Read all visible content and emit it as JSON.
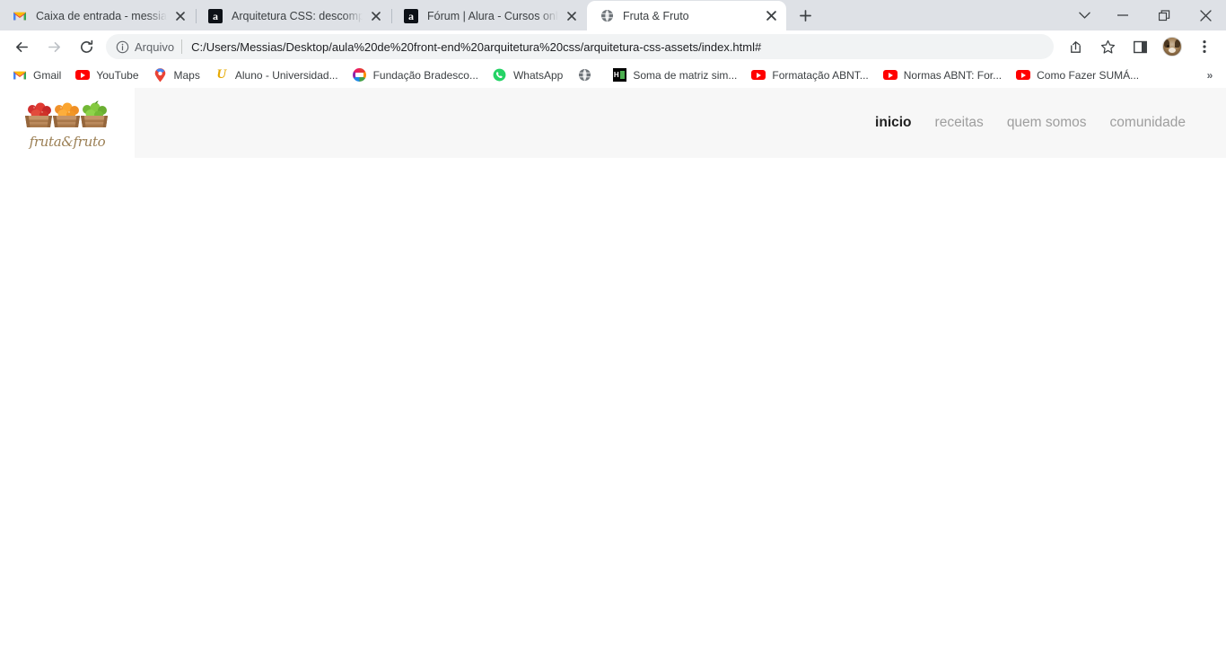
{
  "browser": {
    "tabs": [
      {
        "title": "Caixa de entrada - messias.varelo",
        "favicon": "gmail-icon",
        "active": false
      },
      {
        "title": "Arquitetura CSS: descomplicando",
        "favicon": "alura-icon",
        "active": false
      },
      {
        "title": "Fórum | Alura - Cursos online de",
        "favicon": "alura-icon",
        "active": false
      },
      {
        "title": "Fruta & Fruto",
        "favicon": "globe-icon",
        "active": true
      }
    ],
    "new_tab_label": "+",
    "window_controls": {
      "tab_search": "tab-search-icon",
      "minimize": "minimize-icon",
      "maximize": "maximize-icon",
      "close": "close-icon"
    },
    "toolbar": {
      "back": "back-arrow-icon",
      "forward": "forward-arrow-icon",
      "reload": "reload-icon",
      "omnibox": {
        "info_icon": "info-circle-icon",
        "scheme_label": "Arquivo",
        "url": "C:/Users/Messias/Desktop/aula%20de%20front-end%20arquitetura%20css/arquitetura-css-assets/index.html#"
      },
      "share": "share-icon",
      "bookmark_star": "star-icon",
      "side_panel": "side-panel-icon",
      "profile": "profile-avatar",
      "menu": "three-dot-menu-icon"
    },
    "bookmarks": [
      {
        "label": "Gmail",
        "favicon": "gmail-icon"
      },
      {
        "label": "YouTube",
        "favicon": "youtube-icon"
      },
      {
        "label": "Maps",
        "favicon": "maps-pin-icon"
      },
      {
        "label": "Aluno - Universidad...",
        "favicon": "u-letter-icon"
      },
      {
        "label": "Fundação Bradesco...",
        "favicon": "bradesco-icon"
      },
      {
        "label": "WhatsApp",
        "favicon": "whatsapp-icon"
      },
      {
        "label": "",
        "favicon": "globe-icon"
      },
      {
        "label": "Soma de matriz sim...",
        "favicon": "h-black-green-icon"
      },
      {
        "label": "Formatação ABNT...",
        "favicon": "youtube-icon"
      },
      {
        "label": "Normas ABNT: For...",
        "favicon": "youtube-icon"
      },
      {
        "label": "Como Fazer SUMÁ...",
        "favicon": "youtube-icon"
      }
    ],
    "bookmarks_overflow": "»"
  },
  "site": {
    "logo": {
      "wordmark": "fruta&fruto",
      "art_name": "fruit-crates-logo"
    },
    "nav": [
      {
        "label": "inicio",
        "active": true
      },
      {
        "label": "receitas",
        "active": false
      },
      {
        "label": "quem somos",
        "active": false
      },
      {
        "label": "comunidade",
        "active": false
      }
    ]
  },
  "colors": {
    "tabstrip_bg": "#dee1e6",
    "toolbar_bg": "#ffffff",
    "omnibox_bg": "#f1f3f4",
    "site_header_bg": "#f7f7f7",
    "page_bg": "#ffffff",
    "logo_word": "#9b7f54",
    "nav_inactive": "#9e9e9e",
    "nav_active": "#202020"
  }
}
